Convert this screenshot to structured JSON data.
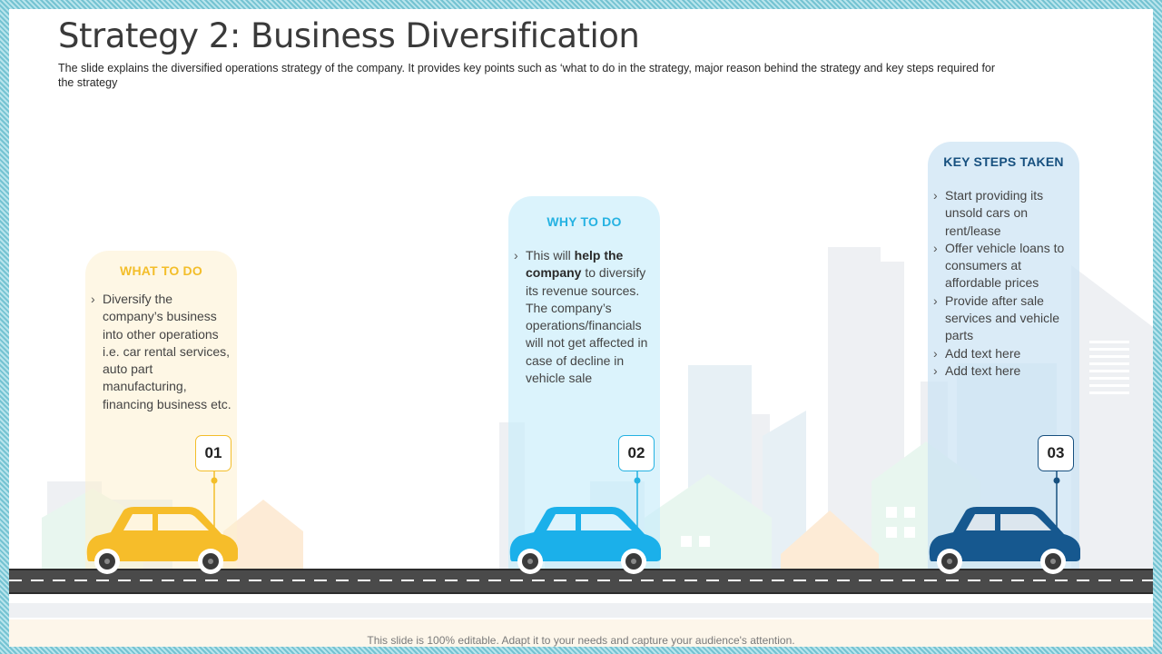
{
  "slide": {
    "title": "Strategy 2: Business Diversification",
    "subtitle": "The slide explains the diversified operations strategy of the company. It provides key points such as ‘what to do in the strategy, major reason behind the strategy and key steps required for the strategy",
    "footer": "This slide is 100% editable. Adapt it to your needs and capture your audience's attention."
  },
  "panels": [
    {
      "heading": "WHAT TO DO",
      "number": "01",
      "color": "#f3be2a",
      "bullets": [
        "Diversify the company’s business into other operations i.e. car rental services, auto part manufacturing, financing business etc."
      ]
    },
    {
      "heading": "WHY TO DO",
      "number": "02",
      "color": "#25b2e2",
      "bullet_parts": {
        "before": "This will ",
        "bold": "help the company",
        "after": " to diversify its revenue sources. The company’s operations/financials will not get affected in case of decline in  vehicle sale"
      }
    },
    {
      "heading": "KEY STEPS TAKEN",
      "number": "03",
      "color": "#17507f",
      "bullets": [
        "Start providing its unsold cars on rent/lease",
        "Offer vehicle loans to consumers at affordable prices",
        "Provide after sale services and vehicle parts",
        "Add text here",
        "Add text here"
      ]
    }
  ],
  "icons": [
    "yellow-car-icon",
    "blue-car-icon",
    "navy-car-icon",
    "city-skyline-illustration",
    "road-illustration"
  ]
}
